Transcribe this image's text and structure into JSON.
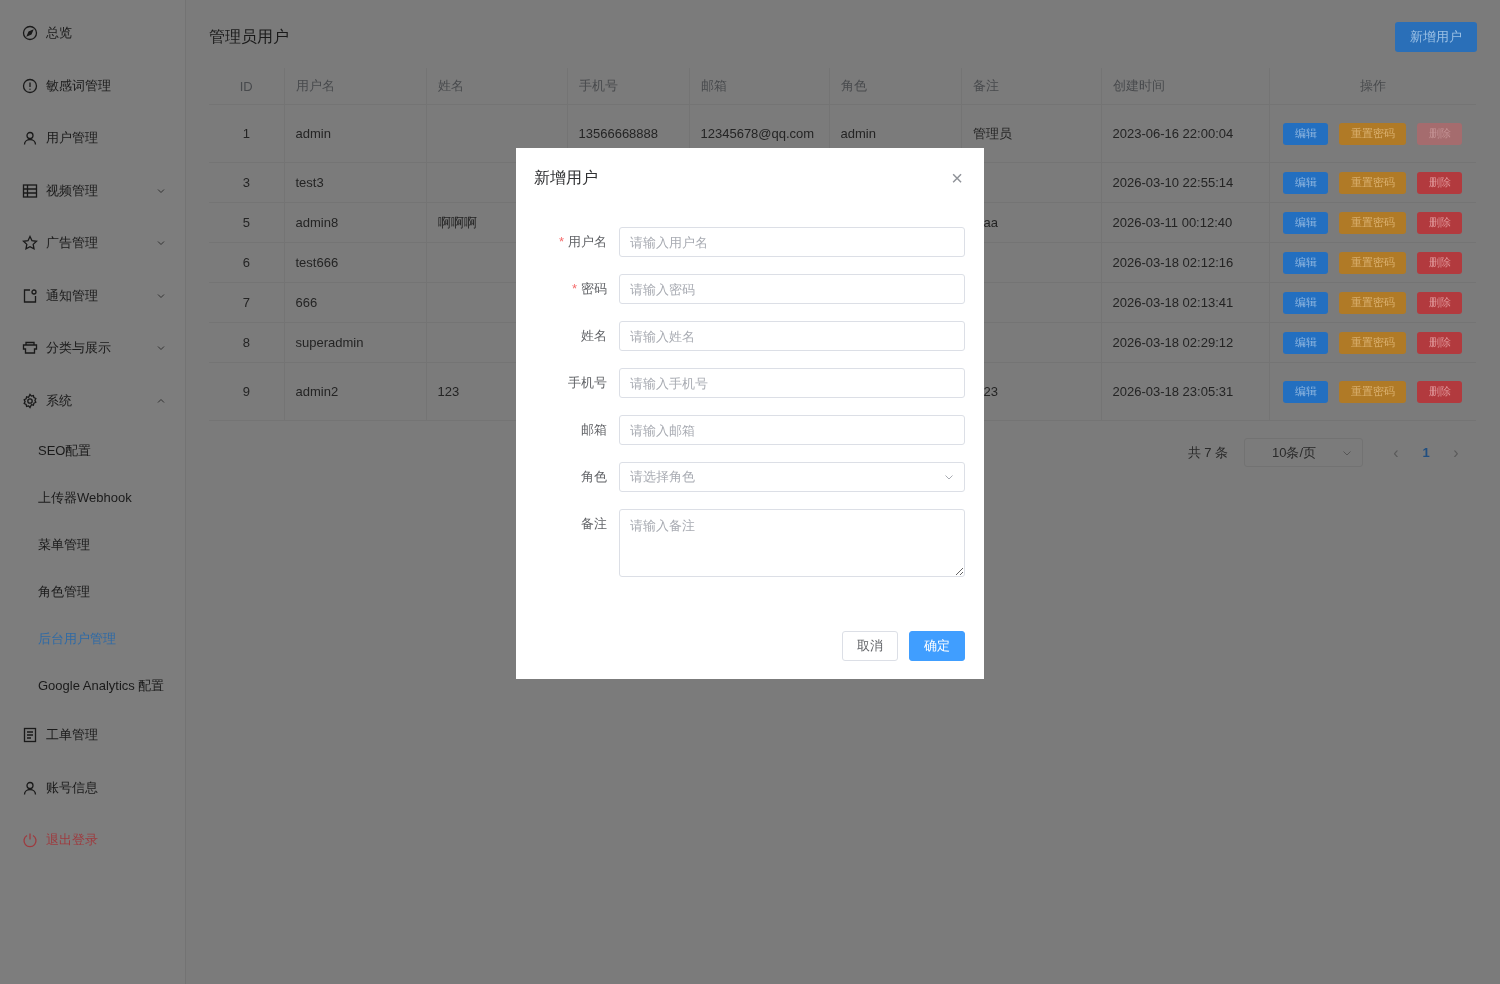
{
  "sidebar": {
    "items": [
      {
        "label": "总览",
        "kind": "normal"
      },
      {
        "label": "敏感词管理",
        "kind": "normal"
      },
      {
        "label": "用户管理",
        "kind": "normal"
      },
      {
        "label": "视频管理",
        "kind": "normal",
        "expanded": false
      },
      {
        "label": "广告管理",
        "kind": "normal",
        "expanded": false
      },
      {
        "label": "通知管理",
        "kind": "normal",
        "expanded": false
      },
      {
        "label": "分类与展示",
        "kind": "normal",
        "expanded": false
      },
      {
        "label": "系统",
        "kind": "normal",
        "expanded": true,
        "children": [
          {
            "label": "SEO配置",
            "selected": false
          },
          {
            "label": "上传器Webhook",
            "selected": false
          },
          {
            "label": "菜单管理",
            "selected": false
          },
          {
            "label": "角色管理",
            "selected": false
          },
          {
            "label": "后台用户管理",
            "selected": true
          },
          {
            "label": "Google Analytics 配置",
            "selected": false
          }
        ]
      },
      {
        "label": "工单管理",
        "kind": "normal"
      },
      {
        "label": "账号信息",
        "kind": "normal"
      },
      {
        "label": "退出登录",
        "kind": "danger"
      }
    ]
  },
  "page": {
    "title": "管理员用户",
    "add_button": "新增用户"
  },
  "table": {
    "columns": [
      "ID",
      "用户名",
      "姓名",
      "手机号",
      "邮箱",
      "角色",
      "备注",
      "创建时间",
      "操作"
    ],
    "rows": [
      {
        "id": "1",
        "username": "admin",
        "phone": "13566668888",
        "email": "12345678@qq.com",
        "role": "admin",
        "note": "管理员",
        "created": "2023-06-16 22:00:04",
        "actions": [
          {
            "label": "编辑",
            "kind": "edit",
            "disabled": false
          },
          {
            "label": "重置密码",
            "kind": "reset",
            "disabled": false
          },
          {
            "label": "删除",
            "kind": "delete",
            "disabled": true
          }
        ]
      },
      {
        "id": "3",
        "username": "test3",
        "created": "2026-03-10 22:55:14",
        "actions": [
          {
            "label": "编辑",
            "kind": "edit",
            "disabled": false
          },
          {
            "label": "重置密码",
            "kind": "reset",
            "disabled": false
          },
          {
            "label": "删除",
            "kind": "delete",
            "disabled": false
          }
        ]
      },
      {
        "id": "5",
        "username": "admin8",
        "name": "啊啊啊",
        "note": "aa",
        "note_cut": true,
        "created": "2026-03-11 00:12:40",
        "actions": [
          {
            "label": "编辑",
            "kind": "edit",
            "disabled": false
          },
          {
            "label": "重置密码",
            "kind": "reset",
            "disabled": false
          },
          {
            "label": "删除",
            "kind": "delete",
            "disabled": false
          }
        ]
      },
      {
        "id": "6",
        "username": "test666",
        "created": "2026-03-18 02:12:16",
        "actions": [
          {
            "label": "编辑",
            "kind": "edit",
            "disabled": false
          },
          {
            "label": "重置密码",
            "kind": "reset",
            "disabled": false
          },
          {
            "label": "删除",
            "kind": "delete",
            "disabled": false
          }
        ]
      },
      {
        "id": "7",
        "username": "666",
        "created": "2026-03-18 02:13:41",
        "actions": [
          {
            "label": "编辑",
            "kind": "edit",
            "disabled": false
          },
          {
            "label": "重置密码",
            "kind": "reset",
            "disabled": false
          },
          {
            "label": "删除",
            "kind": "delete",
            "disabled": false
          }
        ]
      },
      {
        "id": "8",
        "username": "superadmin",
        "created": "2026-03-18 02:29:12",
        "actions": [
          {
            "label": "编辑",
            "kind": "edit",
            "disabled": false
          },
          {
            "label": "重置密码",
            "kind": "reset",
            "disabled": false
          },
          {
            "label": "删除",
            "kind": "delete",
            "disabled": false
          }
        ]
      },
      {
        "id": "9",
        "username": "admin2",
        "name": "123",
        "note": "23",
        "note_cut": true,
        "created": "2026-03-18 23:05:31",
        "actions": [
          {
            "label": "编辑",
            "kind": "edit",
            "disabled": false
          },
          {
            "label": "重置密码",
            "kind": "reset",
            "disabled": false
          },
          {
            "label": "删除",
            "kind": "delete",
            "disabled": false
          }
        ]
      }
    ]
  },
  "pagination": {
    "total": "共 7 条",
    "page_size": "10条/页",
    "prev": "‹",
    "pages": [
      {
        "label": "1",
        "selected": true
      }
    ],
    "next": "›"
  },
  "dialog": {
    "title": "新增用户",
    "close": "×",
    "fields": [
      {
        "label": "用户名",
        "required": true,
        "kind": "input",
        "placeholder": "请输入用户名"
      },
      {
        "label": "密码",
        "required": true,
        "kind": "input",
        "placeholder": "请输入密码"
      },
      {
        "label": "姓名",
        "required": false,
        "kind": "input",
        "placeholder": "请输入姓名"
      },
      {
        "label": "手机号",
        "required": false,
        "kind": "input",
        "placeholder": "请输入手机号"
      },
      {
        "label": "邮箱",
        "required": false,
        "kind": "input",
        "placeholder": "请输入邮箱"
      },
      {
        "label": "角色",
        "required": false,
        "kind": "select",
        "placeholder": "请选择角色"
      },
      {
        "label": "备注",
        "required": false,
        "kind": "textarea",
        "placeholder": "请输入备注"
      }
    ],
    "required_mark": "*",
    "cancel": "取消",
    "confirm": "确定"
  }
}
